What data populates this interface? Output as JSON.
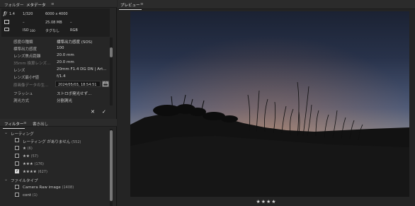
{
  "left_tabs": {
    "folder": "フォルダー",
    "metadata": "メタデータ"
  },
  "exif": {
    "aperture": "1.4",
    "shutter": "1/320",
    "dimensions": "6000 x 4000",
    "value_dash1": "–",
    "filesize": "25.08 MB",
    "value_dash2": "–",
    "iso_label": "ISO",
    "iso_value": "100",
    "tag": "タグなし",
    "color_mode": "RGB"
  },
  "metadata_rows": [
    {
      "label": "感度の種類",
      "value": "標準出力感度 (SOS)"
    },
    {
      "label": "標準出力感度",
      "value": "100"
    },
    {
      "label": "レンズ焦点距離",
      "value": "20.0 mm"
    },
    {
      "label": "35mm 換算レンズ...",
      "value": "20.0 mm"
    },
    {
      "label": "レンズ",
      "value": "20mm F1.4 DG DN | Art..."
    },
    {
      "label": "レンズ最小F値",
      "value": "f/1.4"
    },
    {
      "label": "原画像データの生...",
      "value": "2024/05/03, 18:54:51"
    },
    {
      "label": "フラッシュ",
      "value": "ストロボ発光せず..."
    },
    {
      "label": "測光方式",
      "value": "分割測光"
    }
  ],
  "actions": {
    "cancel": "✕",
    "confirm": "✓"
  },
  "filter_tabs": {
    "filter": "フィルター",
    "export": "書き出し"
  },
  "filters": {
    "rating_group": "レーティング",
    "rating_items": [
      {
        "label": "レーティング がありません",
        "count": "(552)",
        "checked": false
      },
      {
        "label": "★",
        "count": "(6)",
        "checked": false
      },
      {
        "label": "★★",
        "count": "(57)",
        "checked": false
      },
      {
        "label": "★★★",
        "count": "(176)",
        "checked": false
      },
      {
        "label": "★★★★",
        "count": "(627)",
        "checked": true
      }
    ],
    "filetype_group": "ファイルタイプ",
    "filetype_items": [
      {
        "label": "Camera Raw image",
        "count": "(1408)",
        "checked": false
      },
      {
        "label": "cont",
        "count": "(1)",
        "checked": false
      }
    ]
  },
  "preview": {
    "title": "プレビュー",
    "rating": "★★★★"
  },
  "icons": {
    "menu": "menu-icon",
    "aperture": "aperture-icon",
    "wb": "white-balance-icon",
    "metering": "metering-icon",
    "calendar": "calendar-icon"
  }
}
